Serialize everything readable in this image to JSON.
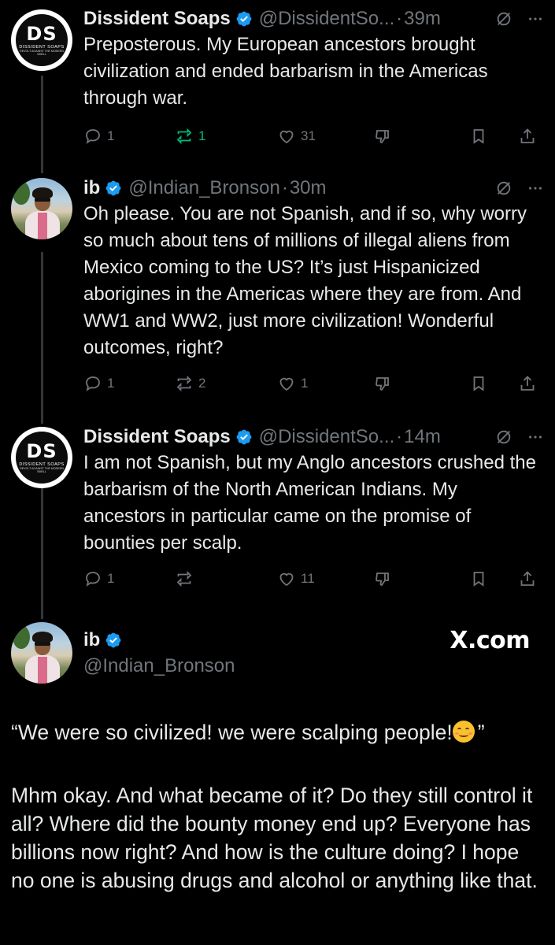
{
  "tweets": [
    {
      "name": "Dissident Soaps",
      "handle": "@DissidentSo...",
      "time": "39m",
      "text": "Preposterous. My European ancestors brought civilization and ended barbarism in the Americas through war.",
      "replies": "1",
      "reposts": "1",
      "likes": "31",
      "reposted_by_user": true
    },
    {
      "name": "ib",
      "handle": "@Indian_Bronson",
      "time": "30m",
      "text": "Oh please. You are not Spanish, and if so, why worry so much about tens of millions of illegal aliens from Mexico coming to the US? It’s just Hispanicized aborigines in the Americas where they are from. And WW1 and WW2, just more civilization! Wonderful outcomes, right?",
      "replies": "1",
      "reposts": "2",
      "likes": "1"
    },
    {
      "name": "Dissident Soaps",
      "handle": "@DissidentSo...",
      "time": "14m",
      "text": "I am not Spanish, but my Anglo ancestors crushed the barbarism of the North American Indians. My ancestors in particular came on the promise of bounties per scalp.",
      "replies": "1",
      "reposts": "",
      "likes": "11"
    }
  ],
  "separator": "·",
  "ds_logo": {
    "letters": "DS",
    "subtitle": "DISSIDENT SOAPS",
    "tagline": "REVOLT AGAINST THE MODERN SMELL"
  },
  "final": {
    "name": "ib",
    "handle": "@Indian_Bronson",
    "watermark": "X.com",
    "quote_text": "“We were so civilized! we were scalping people!",
    "quote_close": "”",
    "body": "Mhm okay. And what became of it? Do they still control it all? Where did the bounty money end up? Everyone has billions now right? And how is the culture doing? I hope no one is abusing drugs and alcohol or anything like that."
  },
  "colors": {
    "background": "#000000",
    "text": "#e7e9ea",
    "muted": "#71767b",
    "verified": "#1d9bf0",
    "repost_active": "#00ba7c"
  }
}
